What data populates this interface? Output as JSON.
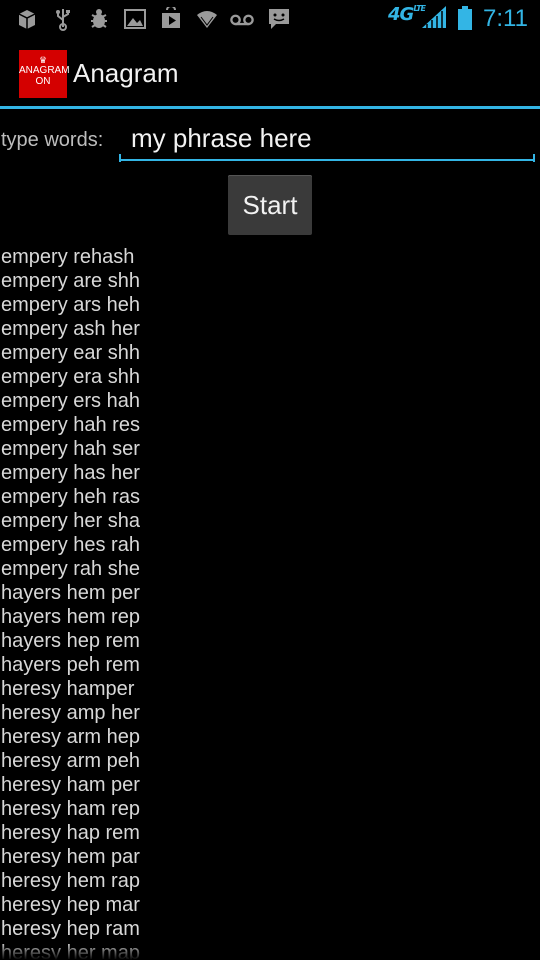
{
  "status_bar": {
    "icons": [
      "box-icon",
      "usb-icon",
      "usb-debug-icon",
      "image-icon",
      "play-store-icon",
      "wifi-icon",
      "voicemail-icon",
      "messenger-icon",
      "signal-icon",
      "battery-icon"
    ],
    "network": "4G",
    "network_sub": "LTE",
    "time": "7:11",
    "accent_color": "#33b5e5"
  },
  "app": {
    "icon_line1": "ANAGRAM",
    "icon_line2": "ON",
    "title": "Anagram",
    "icon_color": "#d40000"
  },
  "form": {
    "label": "type words:",
    "input_value": "my phrase here",
    "start_label": "Start"
  },
  "results": [
    "empery rehash",
    "empery are shh",
    "empery ars heh",
    "empery ash her",
    "empery ear shh",
    "empery era shh",
    "empery ers hah",
    "empery hah res",
    "empery hah ser",
    "empery has her",
    "empery heh ras",
    "empery her sha",
    "empery hes rah",
    "empery rah she",
    "hayers hem per",
    "hayers hem rep",
    "hayers hep rem",
    "hayers peh rem",
    "heresy hamper",
    "heresy amp her",
    "heresy arm hep",
    "heresy arm peh",
    "heresy ham per",
    "heresy ham rep",
    "heresy hap rem",
    "heresy hem par",
    "heresy hem rap",
    "heresy hep mar",
    "heresy hep ram",
    "heresy her map"
  ]
}
